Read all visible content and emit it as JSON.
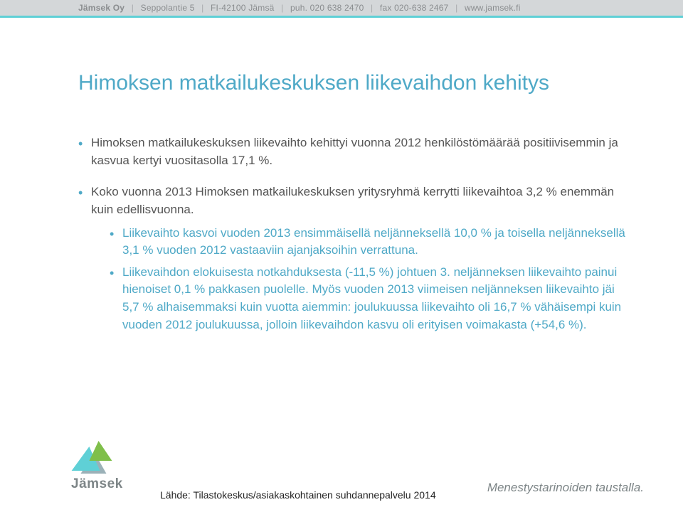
{
  "header": {
    "company": "Jämsek Oy",
    "address": "Seppolantie 5",
    "postal": "FI-42100 Jämsä",
    "phone_label": "puh.",
    "phone": "020 638 2470",
    "fax_label": "fax",
    "fax": "020-638 2467",
    "web": "www.jamsek.fi"
  },
  "slide": {
    "title": "Himoksen matkailukeskuksen liikevaihdon kehitys",
    "bullets": [
      "Himoksen matkailukeskuksen liikevaihto kehittyi vuonna 2012 henkilöstömäärää positiivisemmin ja kasvua kertyi vuositasolla 17,1 %.",
      "Koko vuonna 2013 Himoksen matkailukeskuksen yritysryhmä kerrytti liikevaihtoa 3,2 % enemmän kuin edellisvuonna."
    ],
    "subbullets": [
      "Liikevaihto kasvoi vuoden 2013 ensimmäisellä neljänneksellä 10,0 % ja toisella neljänneksellä 3,1 % vuoden 2012 vastaaviin ajanjaksoihin verrattuna.",
      "Liikevaihdon elokuisesta notkahduksesta (-11,5 %) johtuen 3. neljänneksen liikevaihto painui hienoiset 0,1 % pakkasen puolelle. Myös vuoden 2013 viimeisen neljänneksen liikevaihto jäi 5,7 % alhaisemmaksi kuin vuotta aiemmin: joulukuussa liikevaihto oli 16,7 % vähäisempi kuin vuoden 2012 joulukuussa, jolloin liikevaihdon kasvu oli erityisen voimakasta (+54,6 %)."
    ]
  },
  "footer": {
    "logo_text": "Jämsek",
    "source": "Lähde: Tilastokeskus/asiakaskohtainen suhdannepalvelu 2014",
    "tagline": "Menestystarinoiden taustalla."
  }
}
